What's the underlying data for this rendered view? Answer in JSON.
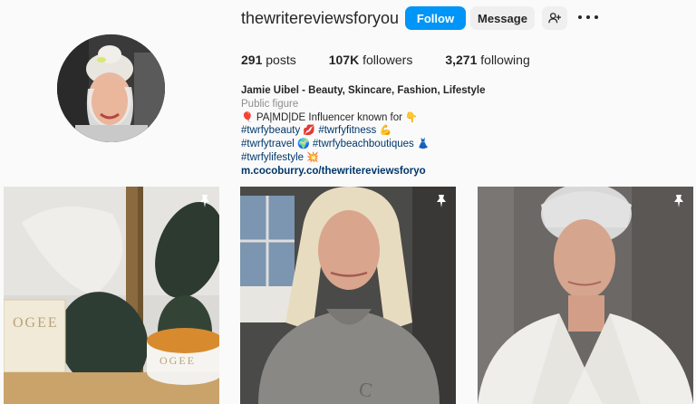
{
  "profile": {
    "username": "thewritereviewsforyou",
    "follow_label": "Follow",
    "message_label": "Message",
    "stats": {
      "posts_count": "291",
      "posts_label": "posts",
      "followers_count": "107K",
      "followers_label": "followers",
      "following_count": "3,271",
      "following_label": "following"
    },
    "bio": {
      "name": "Jamie Uibel - Beauty, Skincare, Fashion, Lifestyle",
      "category": "Public figure",
      "line1": "PA|MD|DE Influencer known for",
      "tag_beauty": "#twrfybeauty",
      "tag_fitness": "#twrfyfitness",
      "tag_travel": "#twrfytravel",
      "tag_beach": "#twrfybeachboutiques",
      "tag_lifestyle": "#twrfylifestyle",
      "link": "m.cocoburry.co/thewritereviewsforyo"
    }
  },
  "posts": [
    {
      "icon": "pin-icon",
      "product_label": "OGEE"
    },
    {
      "icon": "pin-icon"
    },
    {
      "icon": "pin-icon"
    }
  ],
  "colors": {
    "accent": "#0095f6",
    "link": "#00376b",
    "muted": "#8e8e8e",
    "background": "#fafafa"
  }
}
